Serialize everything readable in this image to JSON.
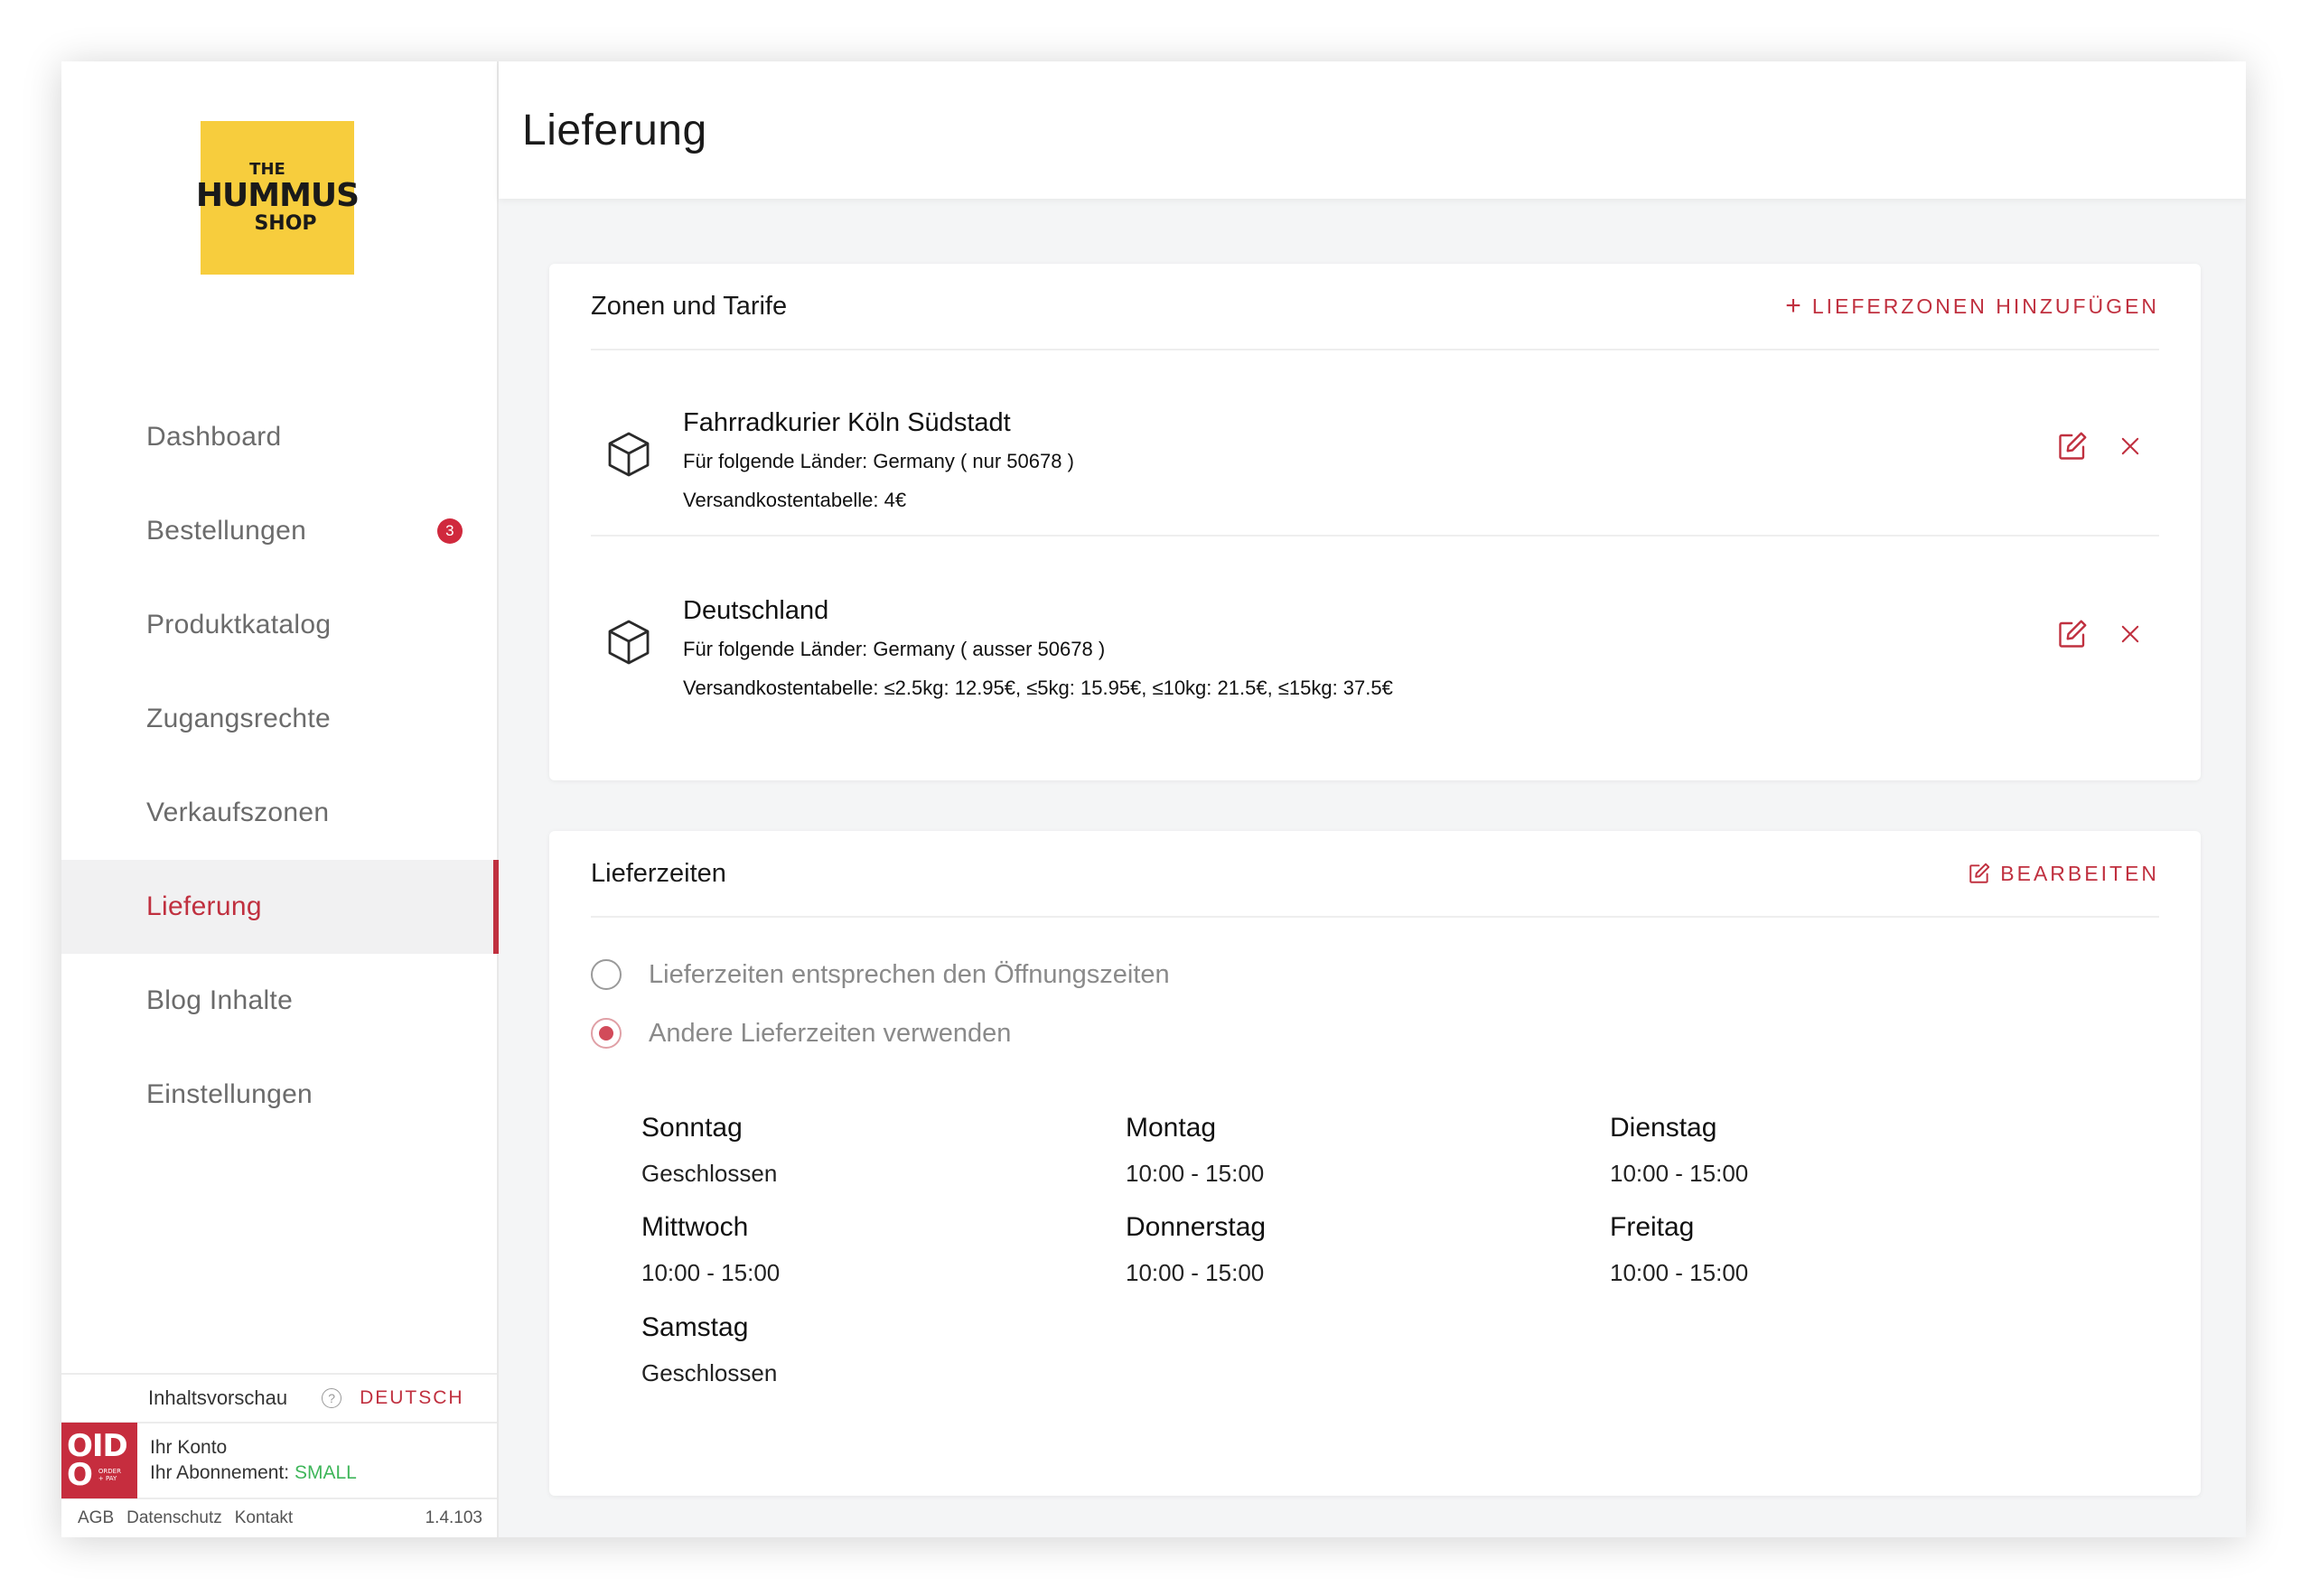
{
  "brand": {
    "logo_line1": "THE",
    "logo_line2": "HUMMUS",
    "logo_line3": "SHOP"
  },
  "sidebar": {
    "items": [
      {
        "label": "Dashboard"
      },
      {
        "label": "Bestellungen",
        "badge": "3"
      },
      {
        "label": "Produktkatalog"
      },
      {
        "label": "Zugangsrechte"
      },
      {
        "label": "Verkaufszonen"
      },
      {
        "label": "Lieferung",
        "active": true
      },
      {
        "label": "Blog Inhalte"
      },
      {
        "label": "Einstellungen"
      }
    ],
    "preview_label": "Inhaltsvorschau",
    "help_glyph": "?",
    "language": "DEUTSCH",
    "oido_line1": "OID",
    "oido_line2": "O",
    "oido_small1": "ORDER",
    "oido_small2": "+ PAY",
    "account_label": "Ihr Konto",
    "subscription_label": "Ihr Abonnement:",
    "subscription_plan": "SMALL",
    "footer_links": [
      "AGB",
      "Datenschutz",
      "Kontakt"
    ],
    "version": "1.4.103"
  },
  "header": {
    "title": "Lieferung"
  },
  "zones_card": {
    "title": "Zonen und Tarife",
    "add_icon": "+",
    "add_label": "LIEFERZONEN HINZUFÜGEN",
    "zones": [
      {
        "name": "Fahrradkurier Köln Südstadt",
        "countries": "Für folgende Länder: Germany ( nur 50678 )",
        "rates": "Versandkostentabelle: 4€"
      },
      {
        "name": "Deutschland",
        "countries": "Für folgende Länder: Germany ( ausser 50678 )",
        "rates": "Versandkostentabelle: ≤2.5kg: 12.95€, ≤5kg: 15.95€, ≤10kg: 21.5€, ≤15kg: 37.5€"
      }
    ]
  },
  "times_card": {
    "title": "Lieferzeiten",
    "edit_label": "BEARBEITEN",
    "options": [
      {
        "label": "Lieferzeiten entsprechen den Öffnungszeiten",
        "checked": false
      },
      {
        "label": "Andere Lieferzeiten verwenden",
        "checked": true
      }
    ],
    "days": [
      {
        "name": "Sonntag",
        "hours": "Geschlossen"
      },
      {
        "name": "Montag",
        "hours": "10:00 - 15:00"
      },
      {
        "name": "Dienstag",
        "hours": "10:00 - 15:00"
      },
      {
        "name": "Mittwoch",
        "hours": "10:00 - 15:00"
      },
      {
        "name": "Donnerstag",
        "hours": "10:00 - 15:00"
      },
      {
        "name": "Freitag",
        "hours": "10:00 - 15:00"
      },
      {
        "name": "Samstag",
        "hours": "Geschlossen"
      }
    ]
  },
  "colors": {
    "accent": "#c0303f",
    "logo_bg": "#f7cd3d",
    "plan_green": "#3fb65a",
    "badge": "#d0293d"
  },
  "icons": {
    "zone": "box-icon",
    "edit": "edit-icon",
    "delete": "close-icon",
    "help": "help-icon"
  }
}
